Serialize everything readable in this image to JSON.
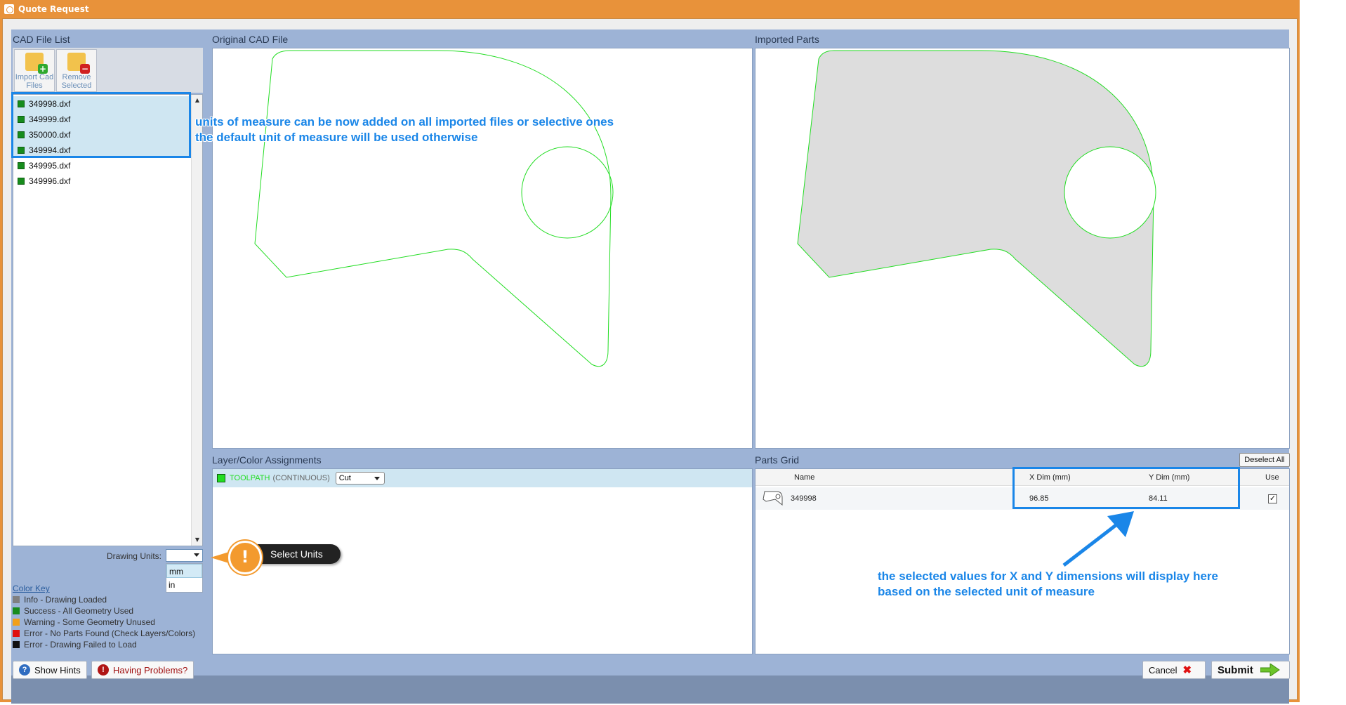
{
  "window": {
    "title": "Quote Request"
  },
  "panels": {
    "cad_file_list": "CAD File List",
    "original_cad": "Original CAD File",
    "imported_parts": "Imported Parts",
    "layer_color": "Layer/Color Assignments",
    "parts_grid": "Parts Grid"
  },
  "toolbar": {
    "import_label": "Import Cad Files",
    "remove_label": "Remove Selected"
  },
  "files": [
    "349998.dxf",
    "349999.dxf",
    "350000.dxf",
    "349994.dxf",
    "349995.dxf",
    "349996.dxf"
  ],
  "drawing_units": {
    "label": "Drawing Units:",
    "value": "",
    "options": [
      "mm",
      "in"
    ]
  },
  "color_key": {
    "title": "Color Key",
    "items": [
      {
        "label": "Info - Drawing Loaded",
        "color": "#808080"
      },
      {
        "label": "Success - All Geometry Used",
        "color": "#178c1c"
      },
      {
        "label": "Warning - Some Geometry Unused",
        "color": "#f2a01a"
      },
      {
        "label": "Error - No Parts Found (Check Layers/Colors)",
        "color": "#e01010"
      },
      {
        "label": "Error - Drawing Failed to Load",
        "color": "#111111"
      }
    ]
  },
  "layer": {
    "name": "TOOLPATH",
    "type": "(CONTINUOUS)",
    "action": "Cut"
  },
  "parts_grid": {
    "deselect_label": "Deselect All",
    "columns": {
      "name": "Name",
      "xdim": "X Dim (mm)",
      "ydim": "Y Dim (mm)",
      "use": "Use"
    },
    "row": {
      "name": "349998",
      "xdim": "96.85",
      "ydim": "84.11",
      "use": "✓"
    }
  },
  "annotations": {
    "units_line1": "units of measure can be now added on all imported files or selective ones",
    "units_line2": "the default unit of measure will be used otherwise",
    "dims_line1": "the selected values for X and Y dimensions will display here",
    "dims_line2": "based on the selected unit of measure",
    "hint": "Select Units",
    "hint_mark": "!"
  },
  "buttons": {
    "show_hints": "Show Hints",
    "having_problems": "Having Problems?",
    "cancel": "Cancel",
    "submit": "Submit"
  },
  "colors": {
    "title_bar": "#e8923a",
    "accent_blue": "#1a86e8",
    "outline_green": "#22dd22",
    "part_fill": "#dddddd"
  }
}
